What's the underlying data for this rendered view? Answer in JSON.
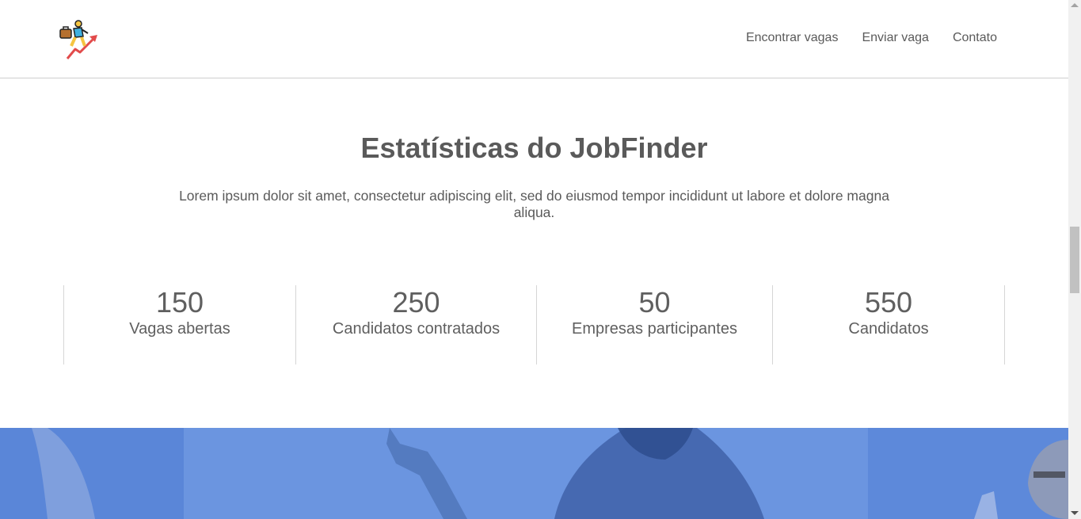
{
  "header": {
    "logo_icon": "climbing-career-icon",
    "nav": [
      {
        "label": "Encontrar vagas"
      },
      {
        "label": "Enviar vaga"
      },
      {
        "label": "Contato"
      }
    ]
  },
  "stats_section": {
    "title": "Estatísticas do JobFinder",
    "description": "Lorem ipsum dolor sit amet, consectetur adipiscing elit, sed do eiusmod tempor incididunt ut labore et dolore magna aliqua.",
    "items": [
      {
        "value": "150",
        "label": "Vagas abertas"
      },
      {
        "value": "250",
        "label": "Candidatos contratados"
      },
      {
        "value": "50",
        "label": "Empresas participantes"
      },
      {
        "value": "550",
        "label": "Candidatos"
      }
    ]
  },
  "banner": {
    "tint_color": "#6b95e0"
  }
}
